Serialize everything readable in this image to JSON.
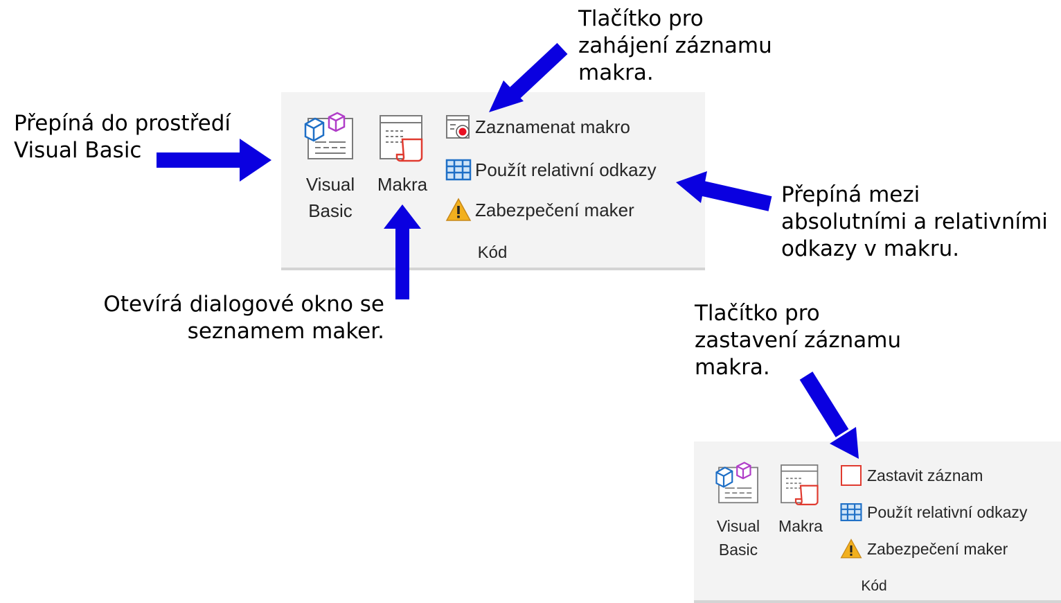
{
  "annotations": {
    "vb_note": [
      "Přepíná do prostředí",
      "Visual Basic"
    ],
    "record_start_note": [
      "Tlačítko pro",
      "zahájení záznamu",
      "makra."
    ],
    "relative_note": [
      "Přepíná mezi",
      "absolutními a relativními",
      "odkazy v makru."
    ],
    "macros_note": [
      "Otevírá dialogové okno se",
      "seznamem maker."
    ],
    "record_stop_note": [
      "Tlačítko pro",
      "zastavení záznamu",
      "makra."
    ]
  },
  "ribbon_before": {
    "visual_basic": [
      "Visual",
      "Basic"
    ],
    "macros": "Makra",
    "record_macro": "Zaznamenat makro",
    "relative_refs": "Použít relativní odkazy",
    "macro_security": "Zabezpečení maker",
    "group": "Kód"
  },
  "ribbon_after": {
    "visual_basic": [
      "Visual",
      "Basic"
    ],
    "macros": "Makra",
    "stop_recording": "Zastavit záznam",
    "relative_refs": "Použít relativní odkazy",
    "macro_security": "Zabezpečení maker",
    "group": "Kód"
  },
  "colors": {
    "arrow": "#0a00e0",
    "ribbon_bg": "#f3f3f3",
    "record_dot": "#e81123",
    "warning": "#f2b01e",
    "grid_blue": "#1e6fc6"
  },
  "icons": [
    "visual-basic-icon",
    "macros-icon",
    "record-macro-icon",
    "stop-recording-icon",
    "relative-references-icon",
    "warning-icon"
  ]
}
